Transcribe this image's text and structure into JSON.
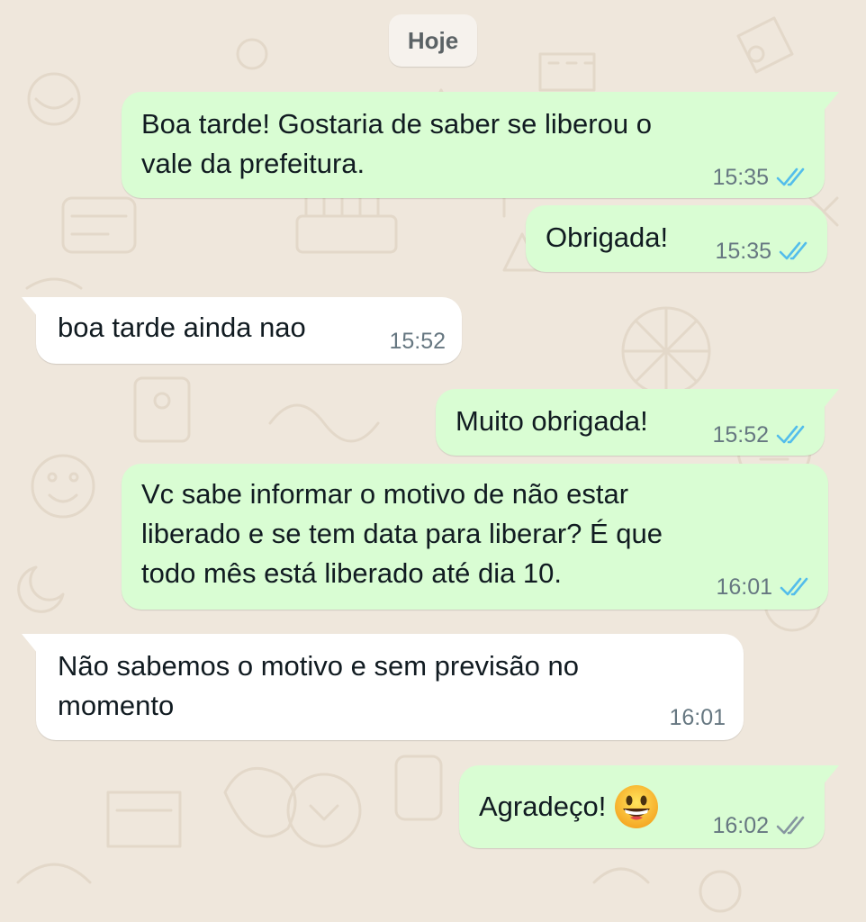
{
  "chat": {
    "date_chip": "Hoje",
    "colors": {
      "outgoing_bubble": "#d9fdd3",
      "incoming_bubble": "#ffffff",
      "background": "#efe7dc",
      "read_ticks": "#53bdeb",
      "delivered_ticks": "#8696a0"
    },
    "messages": [
      {
        "direction": "outgoing",
        "text": "Boa tarde! Gostaria de saber se liberou o\nvale da prefeitura.",
        "time": "15:35",
        "status": "read",
        "status_icon": "double-check-icon"
      },
      {
        "direction": "outgoing",
        "text": "Obrigada!",
        "time": "15:35",
        "status": "read",
        "status_icon": "double-check-icon"
      },
      {
        "direction": "incoming",
        "text": "boa tarde ainda nao",
        "time": "15:52"
      },
      {
        "direction": "outgoing",
        "text": "Muito obrigada!",
        "time": "15:52",
        "status": "read",
        "status_icon": "double-check-icon"
      },
      {
        "direction": "outgoing",
        "text": "Vc sabe informar o motivo de não estar\nliberado e se tem data para liberar? É que\ntodo mês está liberado até dia 10.",
        "time": "16:01",
        "status": "read",
        "status_icon": "double-check-icon"
      },
      {
        "direction": "incoming",
        "text": "Não sabemos o motivo e sem previsão no\nmomento",
        "time": "16:01"
      },
      {
        "direction": "outgoing",
        "text": "Agradeço!",
        "emoji": "grinning-face-icon",
        "time": "16:02",
        "status": "delivered",
        "status_icon": "double-check-icon"
      }
    ]
  }
}
